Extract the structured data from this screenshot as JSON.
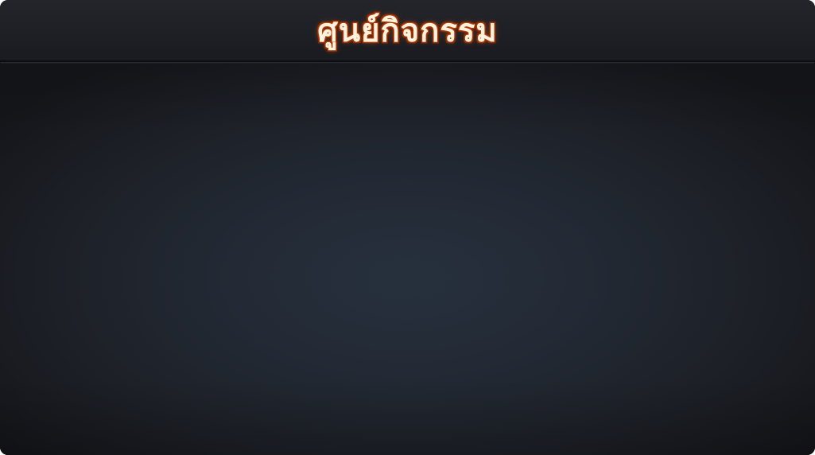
{
  "header": {
    "title": "ศูนย์กิจกรรม"
  },
  "colors": {
    "title_text": "#fff3df",
    "title_outline": "#a33a0a",
    "header_bg": "#1e1f24",
    "content_center": "#26303d",
    "content_edge": "#15161a"
  }
}
